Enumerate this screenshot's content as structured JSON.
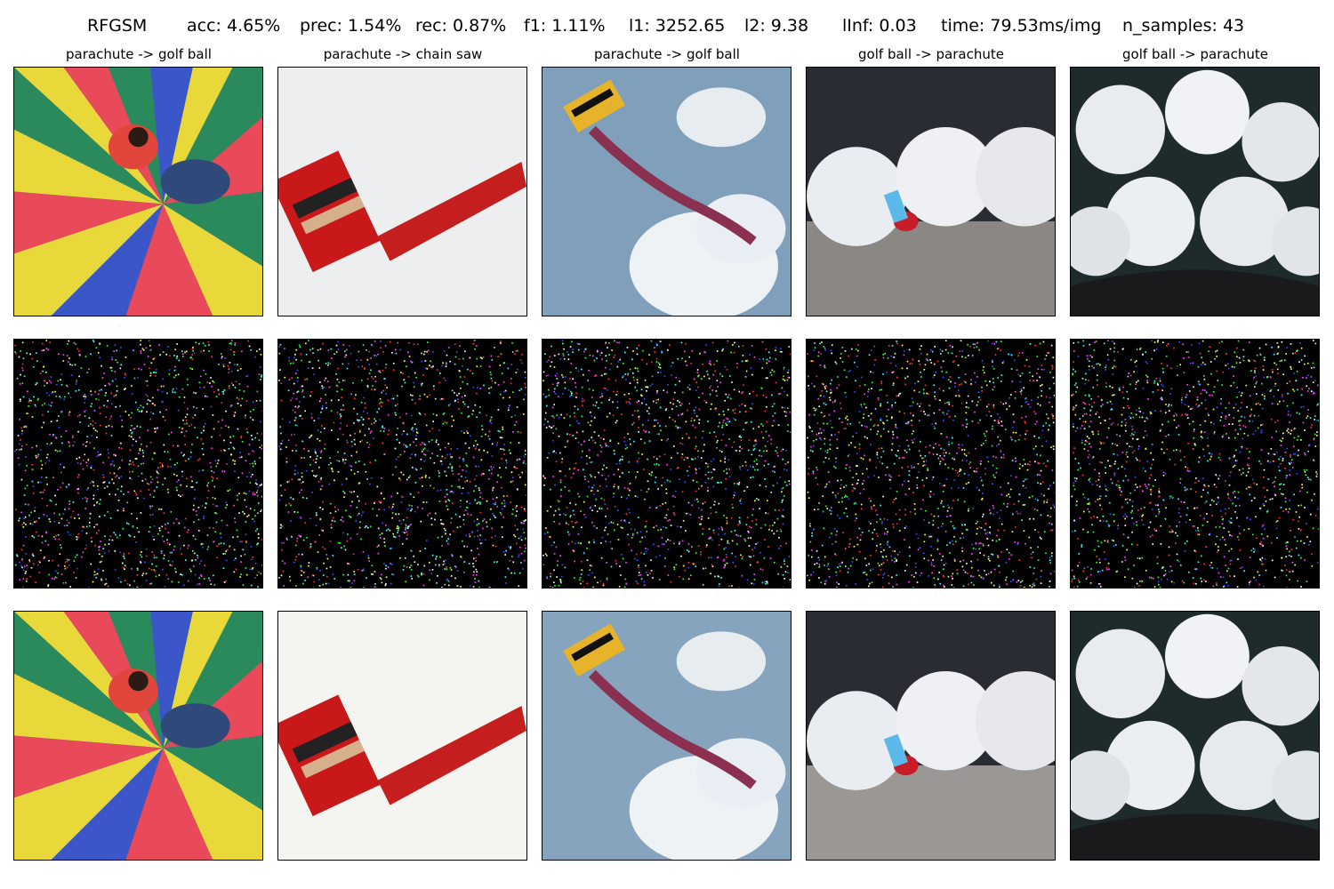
{
  "suptitle": {
    "method": "RFGSM",
    "acc": "acc: 4.65%",
    "prec": "prec: 1.54%",
    "rec": "rec: 0.87%",
    "f1": "f1: 1.11%",
    "l1": "l1: 3252.65",
    "l2": "l2: 9.38",
    "linf": "lInf: 0.03",
    "time": "time: 79.53ms/img",
    "n_samples": "n_samples: 43"
  },
  "columns": [
    {
      "label": "parachute -> golf ball"
    },
    {
      "label": "parachute -> chain saw"
    },
    {
      "label": "parachute -> golf ball"
    },
    {
      "label": "golf ball -> parachute"
    },
    {
      "label": "golf ball -> parachute"
    }
  ],
  "colors": {
    "noise_background": "#000000",
    "noise_dots": [
      "#ff3030",
      "#30ff30",
      "#3050ff",
      "#ffff40",
      "#ff40ff",
      "#40ffff",
      "#ffffff"
    ]
  }
}
